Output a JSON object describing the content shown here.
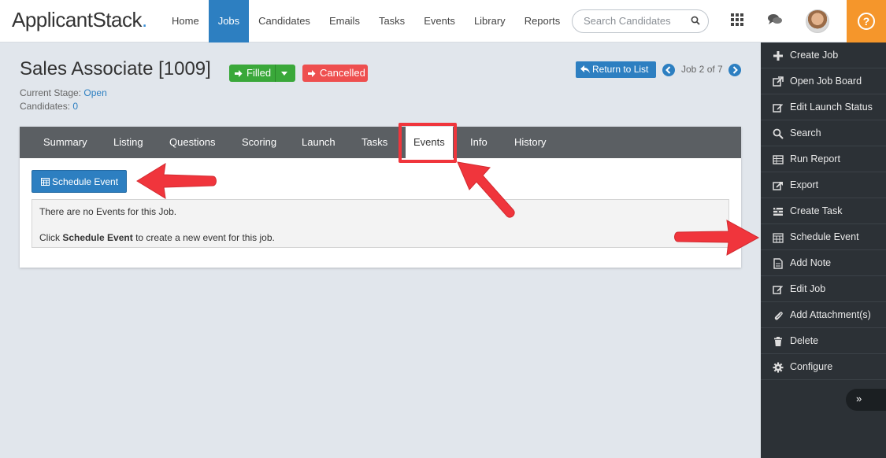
{
  "app": {
    "logo": "ApplicantStack",
    "logo_dot": "."
  },
  "nav": [
    {
      "label": "Home"
    },
    {
      "label": "Jobs",
      "active": true
    },
    {
      "label": "Candidates"
    },
    {
      "label": "Emails"
    },
    {
      "label": "Tasks"
    },
    {
      "label": "Events"
    },
    {
      "label": "Library"
    },
    {
      "label": "Reports"
    }
  ],
  "search": {
    "placeholder": "Search Candidates"
  },
  "job": {
    "title": "Sales Associate [1009]",
    "status_label": "Filled",
    "status2_label": "Cancelled",
    "stage_label": "Current Stage:",
    "stage_value": "Open",
    "candidates_label": "Candidates:",
    "candidates_value": "0"
  },
  "pager": {
    "return_label": "Return to List",
    "position_text": "Job 2 of 7"
  },
  "tabs": [
    {
      "label": "Summary"
    },
    {
      "label": "Listing"
    },
    {
      "label": "Questions"
    },
    {
      "label": "Scoring"
    },
    {
      "label": "Launch"
    },
    {
      "label": "Tasks"
    },
    {
      "label": "Events",
      "active": true
    },
    {
      "label": "Info"
    },
    {
      "label": "History"
    }
  ],
  "events_panel": {
    "schedule_button": "Schedule Event",
    "empty_line1": "There are no Events for this Job.",
    "empty_line2_pre": "Click",
    "empty_line2_bold": "Schedule Event",
    "empty_line2_post": "to create a new event for this job."
  },
  "sidebar": [
    {
      "label": "Create Job",
      "icon": "plus-icon"
    },
    {
      "label": "Open Job Board",
      "icon": "external-link-icon"
    },
    {
      "label": "Edit Launch Status",
      "icon": "edit-icon"
    },
    {
      "label": "Search",
      "icon": "search-icon"
    },
    {
      "label": "Run Report",
      "icon": "table-icon"
    },
    {
      "label": "Export",
      "icon": "export-icon"
    },
    {
      "label": "Create Task",
      "icon": "tasks-icon"
    },
    {
      "label": "Schedule Event",
      "icon": "calendar-icon"
    },
    {
      "label": "Add Note",
      "icon": "note-icon"
    },
    {
      "label": "Edit Job",
      "icon": "edit-icon"
    },
    {
      "label": "Add Attachment(s)",
      "icon": "paperclip-icon"
    },
    {
      "label": "Delete",
      "icon": "trash-icon"
    },
    {
      "label": "Configure",
      "icon": "gear-icon"
    }
  ],
  "sidebar_collapse": "»",
  "colors": {
    "primary": "#2d7fc1",
    "success": "#3aa83a",
    "danger": "#ee4f4f",
    "help": "#f5962b",
    "sidebar": "#2c3136",
    "annotation": "#f0353c"
  }
}
